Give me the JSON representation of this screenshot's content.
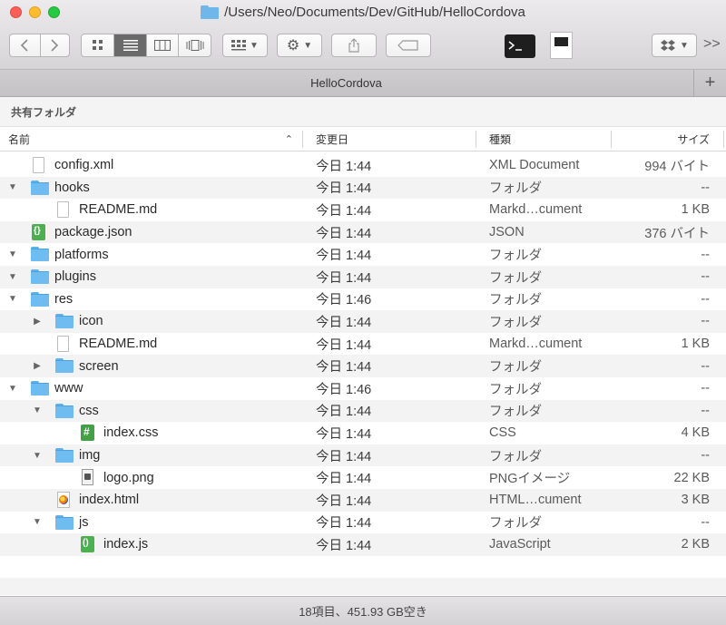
{
  "window": {
    "path": "/Users/Neo/Documents/Dev/GitHub/HelloCordova"
  },
  "toolbar": {
    "back_icon": "chevron-left-icon",
    "forward_icon": "chevron-right-icon",
    "view_icons": [
      "icon-view-icon",
      "list-view-icon",
      "column-view-icon",
      "coverflow-view-icon"
    ],
    "selected_view": "list",
    "overflow": ">>"
  },
  "tabbar": {
    "tab_label": "HelloCordova",
    "add": "+"
  },
  "sidebar_path": {
    "label": "共有フォルダ"
  },
  "columns": {
    "name": "名前",
    "date": "変更日",
    "kind": "種類",
    "size": "サイズ",
    "sort_indicator": "^"
  },
  "rows": [
    {
      "name": "config.xml",
      "date": "今日 1:44",
      "kind": "XML Document",
      "size": "994 バイト",
      "level": 0,
      "disclosure": "",
      "icon": "doc"
    },
    {
      "name": "hooks",
      "date": "今日 1:44",
      "kind": "フォルダ",
      "size": "--",
      "level": 0,
      "disclosure": "▼",
      "icon": "folder"
    },
    {
      "name": "README.md",
      "date": "今日 1:44",
      "kind": "Markd…cument",
      "size": "1 KB",
      "level": 1,
      "disclosure": "",
      "icon": "doc"
    },
    {
      "name": "package.json",
      "date": "今日 1:44",
      "kind": "JSON",
      "size": "376 バイト",
      "level": 0,
      "disclosure": "",
      "icon": "json"
    },
    {
      "name": "platforms",
      "date": "今日 1:44",
      "kind": "フォルダ",
      "size": "--",
      "level": 0,
      "disclosure": "▼",
      "icon": "folder"
    },
    {
      "name": "plugins",
      "date": "今日 1:44",
      "kind": "フォルダ",
      "size": "--",
      "level": 0,
      "disclosure": "▼",
      "icon": "folder"
    },
    {
      "name": "res",
      "date": "今日 1:46",
      "kind": "フォルダ",
      "size": "--",
      "level": 0,
      "disclosure": "▼",
      "icon": "folder"
    },
    {
      "name": "icon",
      "date": "今日 1:44",
      "kind": "フォルダ",
      "size": "--",
      "level": 1,
      "disclosure": "▶",
      "icon": "folder"
    },
    {
      "name": "README.md",
      "date": "今日 1:44",
      "kind": "Markd…cument",
      "size": "1 KB",
      "level": 1,
      "disclosure": "",
      "icon": "doc"
    },
    {
      "name": "screen",
      "date": "今日 1:44",
      "kind": "フォルダ",
      "size": "--",
      "level": 1,
      "disclosure": "▶",
      "icon": "folder"
    },
    {
      "name": "www",
      "date": "今日 1:46",
      "kind": "フォルダ",
      "size": "--",
      "level": 0,
      "disclosure": "▼",
      "icon": "folder"
    },
    {
      "name": "css",
      "date": "今日 1:44",
      "kind": "フォルダ",
      "size": "--",
      "level": 1,
      "disclosure": "▼",
      "icon": "folder"
    },
    {
      "name": "index.css",
      "date": "今日 1:44",
      "kind": "CSS",
      "size": "4 KB",
      "level": 2,
      "disclosure": "",
      "icon": "css"
    },
    {
      "name": "img",
      "date": "今日 1:44",
      "kind": "フォルダ",
      "size": "--",
      "level": 1,
      "disclosure": "▼",
      "icon": "folder"
    },
    {
      "name": "logo.png",
      "date": "今日 1:44",
      "kind": "PNGイメージ",
      "size": "22 KB",
      "level": 2,
      "disclosure": "",
      "icon": "png"
    },
    {
      "name": "index.html",
      "date": "今日 1:44",
      "kind": "HTML…cument",
      "size": "3 KB",
      "level": 1,
      "disclosure": "",
      "icon": "html"
    },
    {
      "name": "js",
      "date": "今日 1:44",
      "kind": "フォルダ",
      "size": "--",
      "level": 1,
      "disclosure": "▼",
      "icon": "folder"
    },
    {
      "name": "index.js",
      "date": "今日 1:44",
      "kind": "JavaScript",
      "size": "2 KB",
      "level": 2,
      "disclosure": "",
      "icon": "js"
    }
  ],
  "status": {
    "text": "18項目、451.93 GB空き"
  },
  "colors": {
    "folder": "#6ebcf0",
    "selected_view": "#6a6a6a"
  }
}
